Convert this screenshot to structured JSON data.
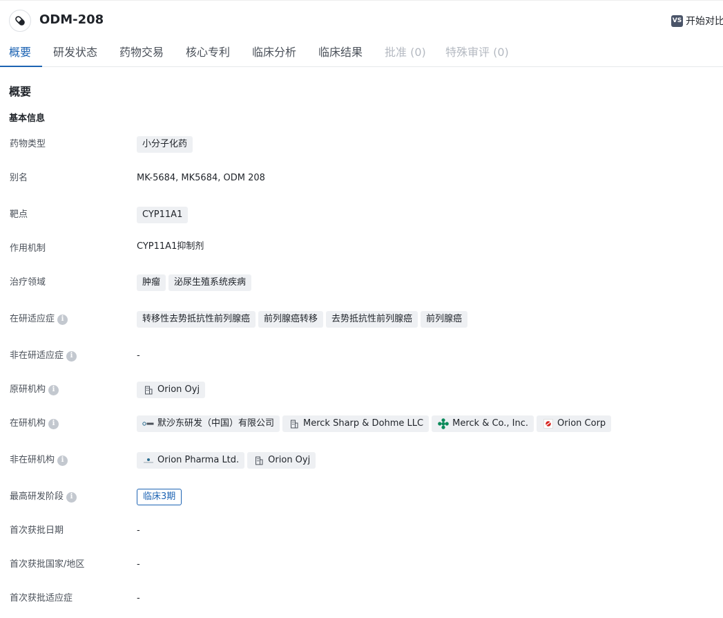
{
  "drug": {
    "name": "ODM-208",
    "icon": "pill-icon"
  },
  "compare": {
    "badge": "VS",
    "label": "开始对比"
  },
  "tabs": [
    {
      "label": "概要",
      "state": "active"
    },
    {
      "label": "研发状态",
      "state": "normal"
    },
    {
      "label": "药物交易",
      "state": "normal"
    },
    {
      "label": "核心专利",
      "state": "normal"
    },
    {
      "label": "临床分析",
      "state": "normal"
    },
    {
      "label": "临床结果",
      "state": "normal"
    },
    {
      "label": "批准 (0)",
      "state": "disabled"
    },
    {
      "label": "特殊审评 (0)",
      "state": "disabled"
    }
  ],
  "section": {
    "title": "概要",
    "subtitle": "基本信息"
  },
  "info_icon_glyph": "i",
  "rows": {
    "drug_type": {
      "label": "药物类型",
      "tags": [
        "小分子化药"
      ]
    },
    "alias": {
      "label": "别名",
      "value": "MK-5684,  MK5684,  ODM 208"
    },
    "target": {
      "label": "靶点",
      "tags": [
        "CYP11A1"
      ]
    },
    "mechanism": {
      "label": "作用机制",
      "value": "CYP11A1抑制剂"
    },
    "therapy_area": {
      "label": "治疗领域",
      "tags": [
        "肿瘤",
        "泌尿生殖系统疾病"
      ]
    },
    "active_indication": {
      "label": "在研适应症",
      "tags": [
        "转移性去势抵抗性前列腺癌",
        "前列腺癌转移",
        "去势抵抗性前列腺癌",
        "前列腺癌"
      ]
    },
    "inactive_indication": {
      "label": "非在研适应症",
      "value": "-"
    },
    "originator": {
      "label": "原研机构",
      "orgs": [
        {
          "name": "Orion Oyj",
          "logo": "building-icon"
        }
      ]
    },
    "active_org": {
      "label": "在研机构",
      "orgs": [
        {
          "name": "默沙东研发（中国）有限公司",
          "logo": "msd-logo"
        },
        {
          "name": "Merck Sharp & Dohme LLC",
          "logo": "building-icon"
        },
        {
          "name": "Merck & Co., Inc.",
          "logo": "merck-logo"
        },
        {
          "name": "Orion Corp",
          "logo": "orion-corp-logo"
        }
      ]
    },
    "inactive_org": {
      "label": "非在研机构",
      "orgs": [
        {
          "name": "Orion Pharma Ltd.",
          "logo": "orion-pharma-logo"
        },
        {
          "name": "Orion Oyj",
          "logo": "building-icon"
        }
      ]
    },
    "highest_phase": {
      "label": "最高研发阶段",
      "value": "临床3期"
    },
    "first_approval_date": {
      "label": "首次获批日期",
      "value": "-"
    },
    "first_approval_country": {
      "label": "首次获批国家/地区",
      "value": "-"
    },
    "first_approval_indication": {
      "label": "首次获批适应症",
      "value": "-"
    }
  },
  "colors": {
    "accent": "#1c63b3",
    "tag_bg": "#eef0f3",
    "muted": "#b4b9c1"
  }
}
